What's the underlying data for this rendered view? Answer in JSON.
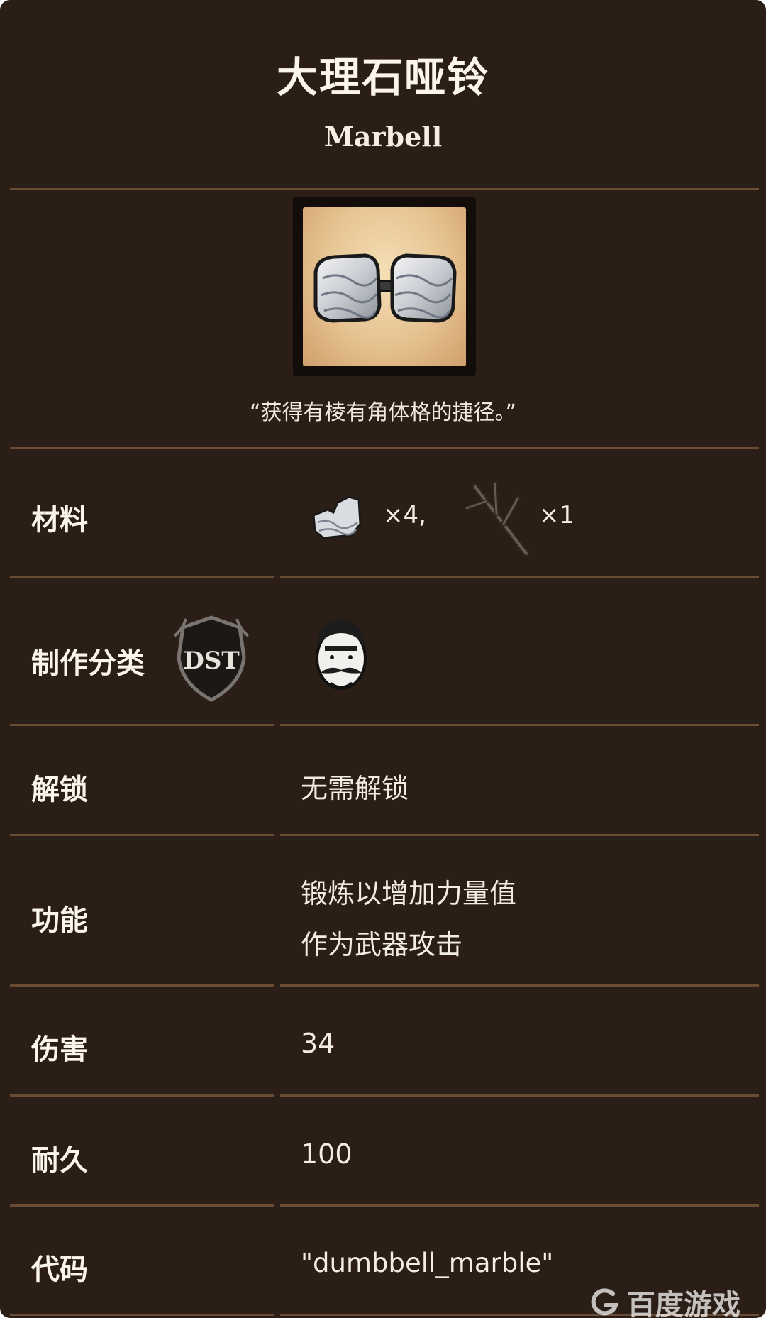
{
  "header": {
    "title": "大理石哑铃",
    "subtitle": "Marbell"
  },
  "item": {
    "image_icon": "marble-dumbbell-icon",
    "quote": "“获得有棱有角体格的捷径。”"
  },
  "rows": {
    "materials": {
      "label": "材料",
      "entries": [
        {
          "icon": "marble-icon",
          "count": "×4,"
        },
        {
          "icon": "twigs-icon",
          "count": "×1"
        }
      ]
    },
    "category": {
      "label": "制作分类",
      "badge_icon": "dst-badge-icon",
      "value_icon": "wolfgang-portrait-icon"
    },
    "unlock": {
      "label": "解锁",
      "value": "无需解锁"
    },
    "function": {
      "label": "功能",
      "line1": "锻炼以增加力量值",
      "line2": "作为武器攻击"
    },
    "damage": {
      "label": "伤害",
      "value": "34"
    },
    "durability": {
      "label": "耐久",
      "value": "100"
    },
    "code": {
      "label": "代码",
      "value": "\"dumbbell_marble\""
    }
  },
  "watermark": {
    "icon": "baidu-games-logo-icon",
    "text": "百度游戏"
  },
  "colors": {
    "background": "#2a1e17",
    "divider": "#6a4c35",
    "text": "#f3ece2",
    "frame_parchment": "#e6c291"
  }
}
